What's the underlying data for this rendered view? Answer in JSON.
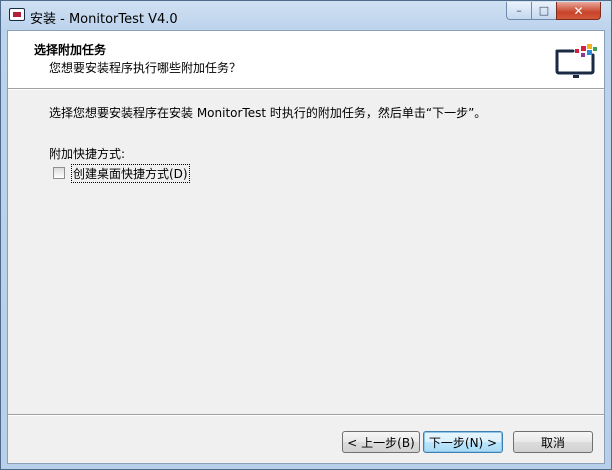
{
  "window": {
    "title": "安装 - MonitorTest V4.0",
    "controls": {
      "minimize": "–",
      "maximize": "□",
      "close": "✕"
    }
  },
  "header": {
    "title": "选择附加任务",
    "subtitle": "您想要安装程序执行哪些附加任务？",
    "logo_icon": "monitor-logo-icon"
  },
  "main": {
    "instruction": "选择您想要安装程序在安装 MonitorTest 时执行的附加任务，然后单击“下一步”。",
    "group_label": "附加快捷方式:",
    "tasks": [
      {
        "label": "创建桌面快捷方式(D)",
        "checked": false
      }
    ]
  },
  "footer": {
    "back_label": "< 上一步(B)",
    "next_label": "下一步(N) >",
    "cancel_label": "取消"
  },
  "colors": {
    "logo_dark": "#1b2a44",
    "logo_accent_red": "#d81f3f",
    "logo_accent_yellow": "#f2b21a",
    "logo_accent_blue": "#2e8bd0",
    "logo_accent_green": "#3aa54b",
    "logo_accent_purple": "#8b3a9a"
  }
}
